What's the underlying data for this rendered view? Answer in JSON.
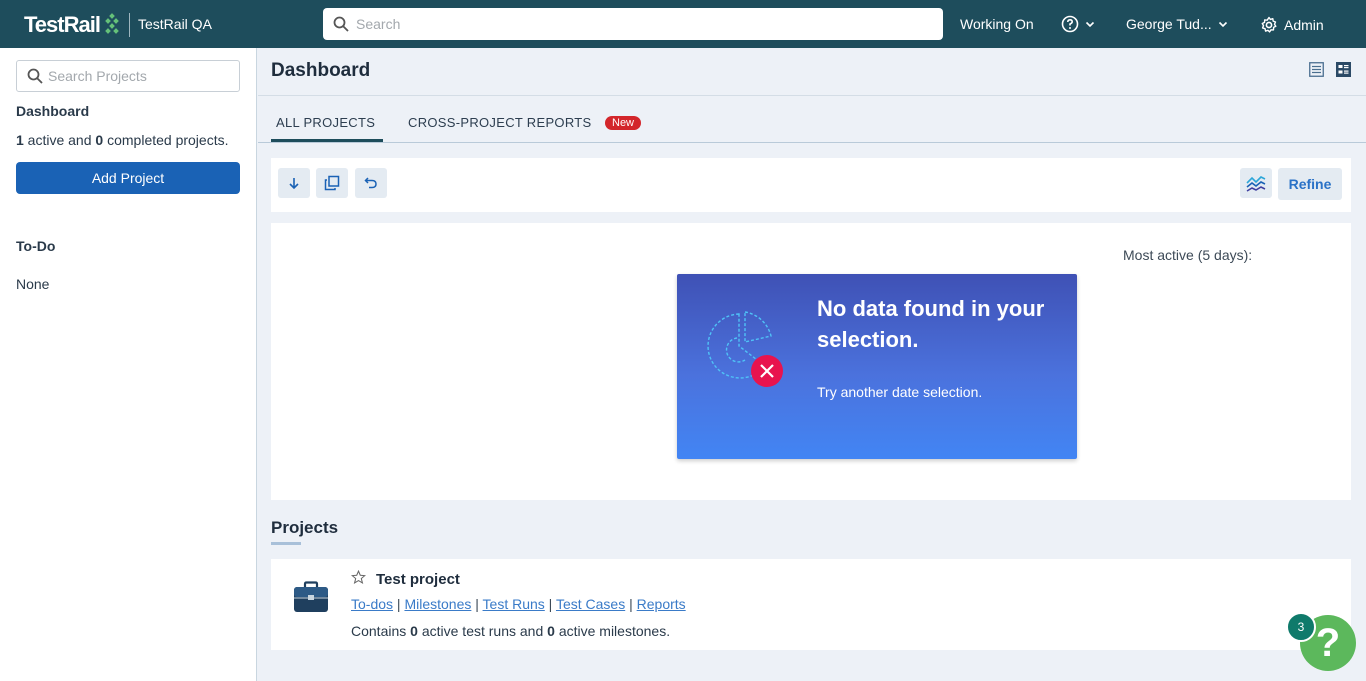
{
  "topbar": {
    "logo_text": "TestRail",
    "instance_name": "TestRail QA",
    "search_placeholder": "Search",
    "working_on": "Working On",
    "user_name": "George Tud...",
    "admin": "Admin"
  },
  "sidebar": {
    "search_placeholder": "Search Projects",
    "dashboard_title": "Dashboard",
    "active_count": "1",
    "active_label": " active and ",
    "completed_count": "0",
    "completed_label": " completed projects.",
    "add_project": "Add Project",
    "todo_title": "To-Do",
    "todo_value": "None"
  },
  "main": {
    "title": "Dashboard",
    "tabs": [
      {
        "label": "ALL PROJECTS",
        "active": true
      },
      {
        "label": "CROSS-PROJECT REPORTS",
        "badge": "New"
      }
    ],
    "toolbar": {
      "refine": "Refine"
    },
    "chart": {
      "most_active": "Most active (5 days):",
      "nodata_title": "No data found in your selection.",
      "nodata_sub": "Try another date selection."
    },
    "projects_title": "Projects",
    "projects": [
      {
        "name": "Test project",
        "links": [
          "To-dos",
          "Milestones",
          "Test Runs",
          "Test Cases",
          "Reports"
        ],
        "desc_prefix": "Contains ",
        "runs": "0",
        "desc_mid": " active test runs and ",
        "milestones": "0",
        "desc_suffix": " active milestones."
      }
    ]
  },
  "help": {
    "count": "3",
    "label": "?"
  },
  "colors": {
    "topbar": "#1e4d5c",
    "primary": "#1a62b5",
    "badge": "#d3262b",
    "help": "#5cb85c"
  }
}
